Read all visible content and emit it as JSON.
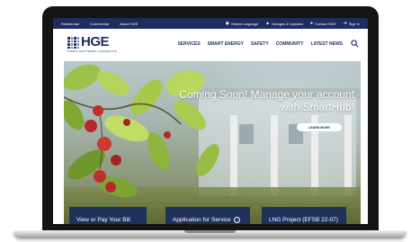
{
  "utility": {
    "left_links": [
      "Residential",
      "Commercial",
      "About HGE"
    ],
    "select_language": "Select Language",
    "outages": "Outages & Updates",
    "contact": "Contact HGE",
    "sign_in": "Sign in"
  },
  "logo": {
    "name": "HGE",
    "tagline": "HARDIN GEOTHERMAL COOPERATIVE"
  },
  "nav": {
    "items": [
      "SERVICES",
      "SMART ENERGY",
      "SAFETY",
      "COMMUNITY",
      "LATEST NEWS"
    ]
  },
  "hero": {
    "headline": "Coming Soon! Manage your account with SmartHub!",
    "cta_label": "LEARN MORE"
  },
  "cards": [
    {
      "label": "View or Pay Your Bill"
    },
    {
      "label": "Application for Service"
    },
    {
      "label": "LNG Project (EFSB 22-07)"
    }
  ],
  "colors": {
    "brand_navy": "#1c2d5e",
    "berry_red": "#b8282b",
    "leaf_green": "#8fb83a"
  },
  "icons": [
    "globe-icon",
    "warning-icon",
    "person-icon",
    "sign-in-icon",
    "search-icon",
    "arrow-circle-icon"
  ]
}
